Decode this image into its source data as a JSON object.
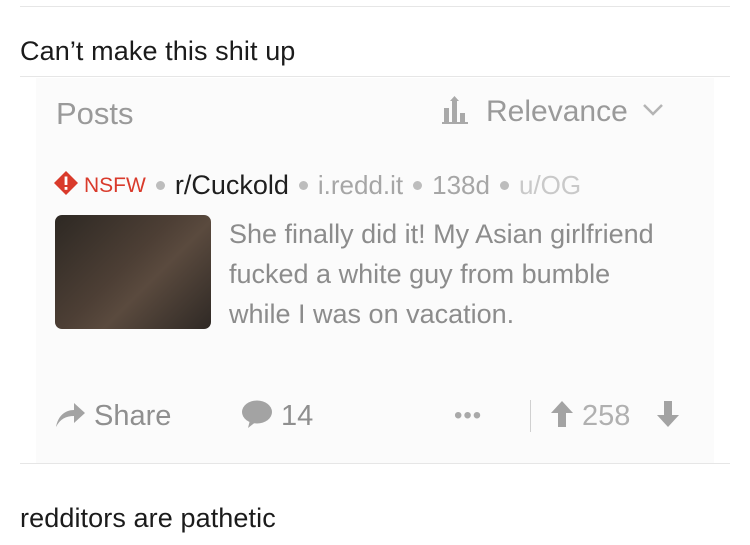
{
  "top_caption": "Can’t make this shit up",
  "bottom_caption": "redditors are pathetic",
  "results": {
    "header_label": "Posts",
    "sort_label": "Relevance"
  },
  "post": {
    "nsfw_label": "NSFW",
    "subreddit": "r/Cuckold",
    "domain": "i.redd.it",
    "age": "138d",
    "author": "u/OG",
    "title": "She finally did it! My Asian girlfriend fucked a white guy from bumble while I was on vacation.",
    "share_label": "Share",
    "comment_count": "14",
    "more_label": "•••",
    "score": "258"
  },
  "colors": {
    "nsfw": "#d93a2b",
    "muted": "#9a9a9a",
    "card_bg": "#fbfbfb"
  },
  "icons": [
    "nsfw-warning-icon",
    "sort-icon",
    "chevron-down-icon",
    "share-arrow-icon",
    "comment-icon",
    "more-icon",
    "upvote-icon",
    "downvote-icon"
  ]
}
